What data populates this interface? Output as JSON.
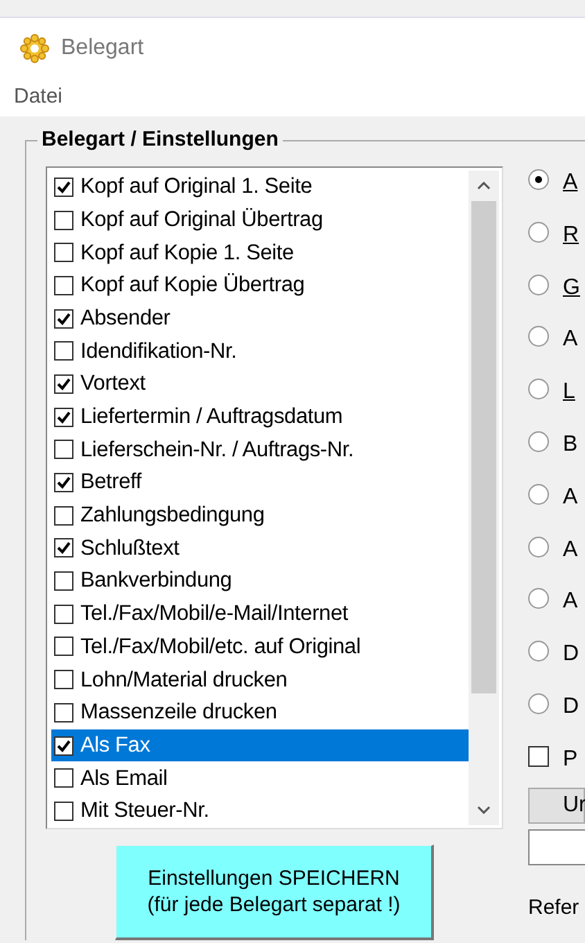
{
  "window": {
    "title": "Belegart"
  },
  "menu": [
    "Datei"
  ],
  "group": {
    "title": "Belegart / Einstellungen"
  },
  "options": [
    {
      "label": "Kopf auf Original 1. Seite",
      "checked": true,
      "selected": false
    },
    {
      "label": "Kopf auf Original Übertrag",
      "checked": false,
      "selected": false
    },
    {
      "label": "Kopf auf Kopie 1. Seite",
      "checked": false,
      "selected": false
    },
    {
      "label": "Kopf auf Kopie Übertrag",
      "checked": false,
      "selected": false
    },
    {
      "label": "Absender",
      "checked": true,
      "selected": false
    },
    {
      "label": "Idendifikation-Nr.",
      "checked": false,
      "selected": false
    },
    {
      "label": "Vortext",
      "checked": true,
      "selected": false
    },
    {
      "label": "Liefertermin / Auftragsdatum",
      "checked": true,
      "selected": false
    },
    {
      "label": "Lieferschein-Nr. / Auftrags-Nr.",
      "checked": false,
      "selected": false
    },
    {
      "label": "Betreff",
      "checked": true,
      "selected": false
    },
    {
      "label": "Zahlungsbedingung",
      "checked": false,
      "selected": false
    },
    {
      "label": "Schlußtext",
      "checked": true,
      "selected": false
    },
    {
      "label": "Bankverbindung",
      "checked": false,
      "selected": false
    },
    {
      "label": "Tel./Fax/Mobil/e-Mail/Internet",
      "checked": false,
      "selected": false
    },
    {
      "label": "Tel./Fax/Mobil/etc. auf Original",
      "checked": false,
      "selected": false
    },
    {
      "label": "Lohn/Material drucken",
      "checked": false,
      "selected": false
    },
    {
      "label": "Massenzeile drucken",
      "checked": false,
      "selected": false
    },
    {
      "label": "Als Fax",
      "checked": true,
      "selected": true
    },
    {
      "label": "Als Email",
      "checked": false,
      "selected": false
    },
    {
      "label": "Mit Steuer-Nr.",
      "checked": false,
      "selected": false
    }
  ],
  "save_button": {
    "lines": [
      "Einstellungen SPEICHERN",
      "(für jede Belegart separat !)"
    ]
  },
  "belegart_radios": [
    {
      "label": "A",
      "selected": true,
      "mnemonic": true
    },
    {
      "label": "R",
      "selected": false,
      "mnemonic": true
    },
    {
      "label": "G",
      "selected": false,
      "mnemonic": true
    },
    {
      "label": "A",
      "selected": false,
      "mnemonic": false
    },
    {
      "label": "L",
      "selected": false,
      "mnemonic": true
    },
    {
      "label": "B",
      "selected": false,
      "mnemonic": false
    },
    {
      "label": "A",
      "selected": false,
      "mnemonic": false
    },
    {
      "label": "A",
      "selected": false,
      "mnemonic": false
    },
    {
      "label": "A",
      "selected": false,
      "mnemonic": false
    },
    {
      "label": "D",
      "selected": false,
      "mnemonic": false
    },
    {
      "label": "D",
      "selected": false,
      "mnemonic": false
    }
  ],
  "side_checkbox": {
    "label": "P",
    "checked": false
  },
  "side_button": {
    "label": "Ur"
  },
  "side_label": "Refer"
}
